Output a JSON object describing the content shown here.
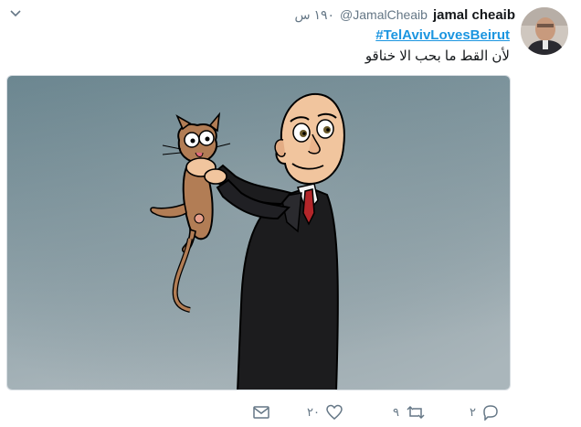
{
  "user": {
    "name": "jamal cheaib",
    "handle": "@JamalCheaib",
    "time": "١٩٠ س"
  },
  "tweet": {
    "hashtag": "#TelAvivLovesBeirut",
    "text": "لأن القط ما بحب الا خناقو"
  },
  "actions": {
    "reply_count": "٢",
    "retweet_count": "٩",
    "like_count": "٢٠"
  },
  "icons": {
    "caret": "chevron-down-icon",
    "reply": "reply-icon",
    "retweet": "retweet-icon",
    "like": "heart-icon",
    "message": "envelope-icon"
  },
  "colors": {
    "link": "#1b95e0",
    "muted": "#657786",
    "media_bg_top": "#6c8791",
    "media_bg_bottom": "#aab6bb"
  }
}
